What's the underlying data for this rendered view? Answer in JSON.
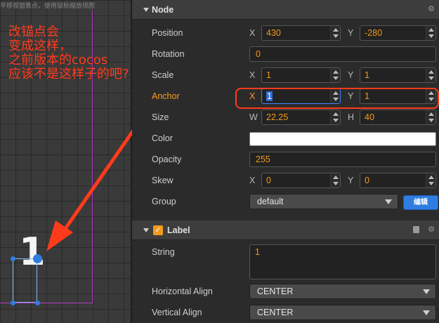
{
  "scene": {
    "hint_text": "平移视窗焦点，使用鼠标缩放视图",
    "annotation_lines": [
      "改锚点会",
      "变成这样，",
      "之前版本的cocos",
      "应该不是这样子的吧?"
    ],
    "node_text": "1",
    "annotation_color": "#ff3b1c",
    "handle_color": "#2f7de1"
  },
  "node_section": {
    "title": "Node",
    "position": {
      "label": "Position",
      "x_axis": "X",
      "x": "430",
      "y_axis": "Y",
      "y": "-280"
    },
    "rotation": {
      "label": "Rotation",
      "value": "0"
    },
    "scale": {
      "label": "Scale",
      "x_axis": "X",
      "x": "1",
      "y_axis": "Y",
      "y": "1"
    },
    "anchor": {
      "label": "Anchor",
      "x_axis": "X",
      "x": "1",
      "y_axis": "Y",
      "y": "1"
    },
    "size": {
      "label": "Size",
      "w_axis": "W",
      "w": "22.25",
      "h_axis": "H",
      "h": "40"
    },
    "color": {
      "label": "Color",
      "value": "#ffffff"
    },
    "opacity": {
      "label": "Opacity",
      "value": "255"
    },
    "skew": {
      "label": "Skew",
      "x_axis": "X",
      "x": "0",
      "y_axis": "Y",
      "y": "0"
    },
    "group": {
      "label": "Group",
      "value": "default",
      "edit_button": "编辑"
    }
  },
  "label_section": {
    "title": "Label",
    "enabled": true,
    "string": {
      "label": "String",
      "value": "1"
    },
    "horizontal_align": {
      "label": "Horizontal Align",
      "value": "CENTER"
    },
    "vertical_align": {
      "label": "Vertical Align",
      "value": "CENTER"
    }
  },
  "colors": {
    "accent_orange": "#f29b1e",
    "active_label": "#ff9c1a",
    "button_blue": "#2f7de1"
  }
}
